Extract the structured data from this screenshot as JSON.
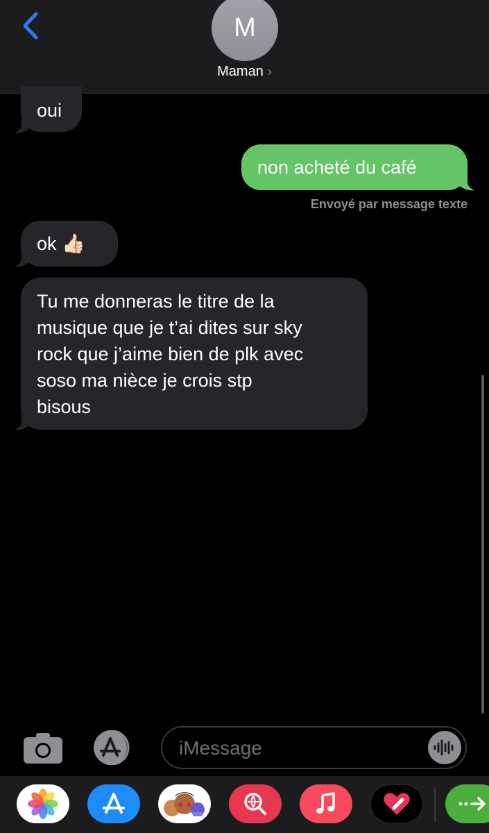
{
  "header": {
    "contact_initial": "M",
    "contact_name": "Maman",
    "contact_chevron": "›"
  },
  "messages": [
    {
      "direction": "incoming",
      "text": "oui"
    },
    {
      "direction": "outgoing",
      "text": "non acheté du café"
    },
    {
      "direction": "incoming",
      "text": "ok 👍🏻"
    },
    {
      "direction": "incoming",
      "lines": [
        "Tu me donneras le titre de la",
        "musique que je t’ai dites sur sky",
        "rock que j’aime bien de plk avec",
        "soso ma nièce je crois stp",
        "bisous"
      ]
    }
  ],
  "status": {
    "sent_as_text": "Envoyé par message texte"
  },
  "compose": {
    "placeholder": "iMessage"
  },
  "app_drawer": [
    "photos-icon",
    "app-store-icon",
    "memoji-icon",
    "images-search-icon",
    "music-icon",
    "digital-touch-icon",
    "more-apps-icon"
  ],
  "colors": {
    "outgoing_bubble": "#65c466",
    "incoming_bubble": "#26252a",
    "accent_blue": "#2f7cf6",
    "header_bg": "#1c1c1e"
  }
}
